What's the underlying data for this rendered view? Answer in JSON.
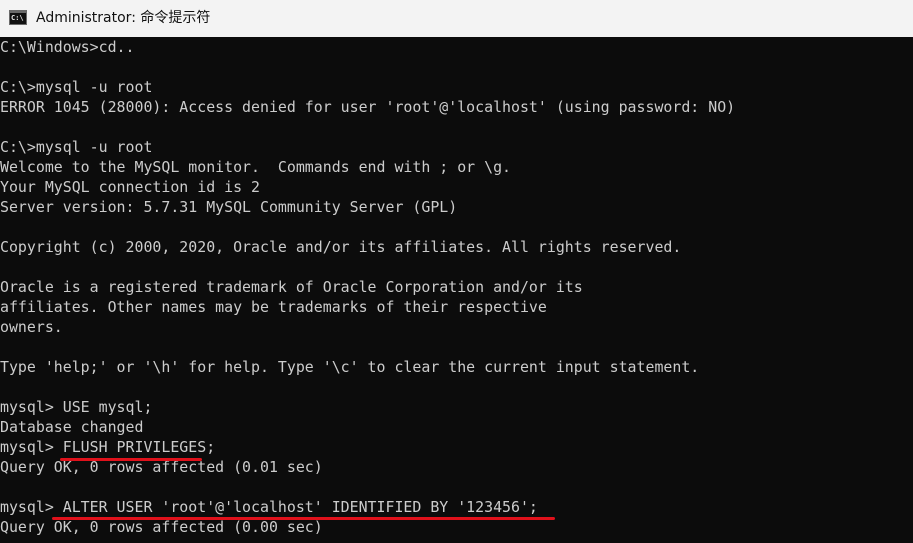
{
  "window": {
    "title": "Administrator: 命令提示符",
    "icon": "cmd-icon",
    "icon_label": "C:\\",
    "annotation_color": "#e0111b"
  },
  "console": {
    "lines": [
      "C:\\Windows>cd..",
      "",
      "C:\\>mysql -u root",
      "ERROR 1045 (28000): Access denied for user 'root'@'localhost' (using password: NO)",
      "",
      "C:\\>mysql -u root",
      "Welcome to the MySQL monitor.  Commands end with ; or \\g.",
      "Your MySQL connection id is 2",
      "Server version: 5.7.31 MySQL Community Server (GPL)",
      "",
      "Copyright (c) 2000, 2020, Oracle and/or its affiliates. All rights reserved.",
      "",
      "Oracle is a registered trademark of Oracle Corporation and/or its",
      "affiliates. Other names may be trademarks of their respective",
      "owners.",
      "",
      "Type 'help;' or '\\h' for help. Type '\\c' to clear the current input statement.",
      "",
      "mysql> USE mysql;",
      "Database changed",
      "mysql> FLUSH PRIVILEGES;",
      "Query OK, 0 rows affected (0.01 sec)",
      "",
      "mysql> ALTER USER 'root'@'localhost' IDENTIFIED BY '123456';",
      "Query OK, 0 rows affected (0.00 sec)"
    ]
  }
}
